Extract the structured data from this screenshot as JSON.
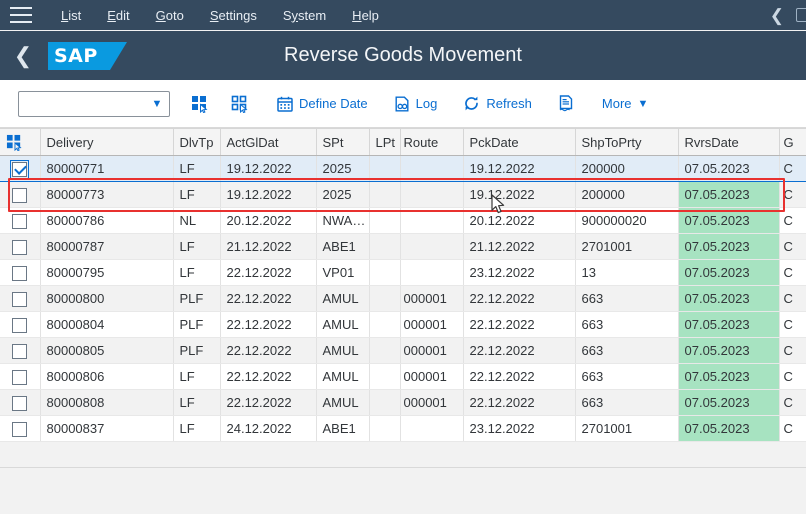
{
  "menubar": {
    "hamburger_icon": "hamburger-menu-icon",
    "items": [
      {
        "label": "List",
        "accel": "L"
      },
      {
        "label": "Edit",
        "accel": "E"
      },
      {
        "label": "Goto",
        "accel": "G"
      },
      {
        "label": "Settings",
        "accel": "S"
      },
      {
        "label": "System",
        "accel": "y"
      },
      {
        "label": "Help",
        "accel": "H"
      }
    ],
    "back_icon": "chevron-left-icon",
    "window_icon": "window-square-icon"
  },
  "shellbar": {
    "back_icon": "chevron-left-icon",
    "logo_text": "SAP",
    "title": "Reverse Goods Movement"
  },
  "toolbar": {
    "combo_value": "",
    "combo_placeholder": "",
    "combo_arrow_icon": "chevron-down-icon",
    "select_all_icon": "select-all-icon",
    "deselect_all_icon": "deselect-all-icon",
    "define_date_label": "Define Date",
    "define_date_icon": "calendar-icon",
    "log_label": "Log",
    "log_icon": "log-document-icon",
    "refresh_label": "Refresh",
    "refresh_icon": "refresh-icon",
    "detail_icon": "document-list-icon",
    "more_label": "More",
    "more_icon": "chevron-down-icon"
  },
  "table": {
    "select_all_header_icon": "select-all-icon",
    "columns": [
      "Delivery",
      "DlvTp",
      "ActGlDat",
      "SPt",
      "LPt",
      "Route",
      "PckDate",
      "ShpToPrty",
      "RvrsDate",
      "G"
    ],
    "rows": [
      {
        "selected": true,
        "delivery": "80000771",
        "dlvtp": "LF",
        "actgldat": "19.12.2022",
        "spt": "2025",
        "lpt": "",
        "route": "",
        "pckdate": "19.12.2022",
        "shptoprty": "200000",
        "rvrsdate": "07.05.2023",
        "g": "C"
      },
      {
        "selected": false,
        "delivery": "80000773",
        "dlvtp": "LF",
        "actgldat": "19.12.2022",
        "spt": "2025",
        "lpt": "",
        "route": "",
        "pckdate": "19.12.2022",
        "shptoprty": "200000",
        "rvrsdate": "07.05.2023",
        "g": "C"
      },
      {
        "selected": false,
        "delivery": "80000786",
        "dlvtp": "NL",
        "actgldat": "20.12.2022",
        "spt": "NWA…",
        "lpt": "",
        "route": "",
        "pckdate": "20.12.2022",
        "shptoprty": "900000020",
        "rvrsdate": "07.05.2023",
        "g": "C"
      },
      {
        "selected": false,
        "delivery": "80000787",
        "dlvtp": "LF",
        "actgldat": "21.12.2022",
        "spt": "ABE1",
        "lpt": "",
        "route": "",
        "pckdate": "21.12.2022",
        "shptoprty": "2701001",
        "rvrsdate": "07.05.2023",
        "g": "C"
      },
      {
        "selected": false,
        "delivery": "80000795",
        "dlvtp": "LF",
        "actgldat": "22.12.2022",
        "spt": "VP01",
        "lpt": "",
        "route": "",
        "pckdate": "23.12.2022",
        "shptoprty": "13",
        "rvrsdate": "07.05.2023",
        "g": "C"
      },
      {
        "selected": false,
        "delivery": "80000800",
        "dlvtp": "PLF",
        "actgldat": "22.12.2022",
        "spt": "AMUL",
        "lpt": "",
        "route": "000001",
        "pckdate": "22.12.2022",
        "shptoprty": "663",
        "rvrsdate": "07.05.2023",
        "g": "C"
      },
      {
        "selected": false,
        "delivery": "80000804",
        "dlvtp": "PLF",
        "actgldat": "22.12.2022",
        "spt": "AMUL",
        "lpt": "",
        "route": "000001",
        "pckdate": "22.12.2022",
        "shptoprty": "663",
        "rvrsdate": "07.05.2023",
        "g": "C"
      },
      {
        "selected": false,
        "delivery": "80000805",
        "dlvtp": "PLF",
        "actgldat": "22.12.2022",
        "spt": "AMUL",
        "lpt": "",
        "route": "000001",
        "pckdate": "22.12.2022",
        "shptoprty": "663",
        "rvrsdate": "07.05.2023",
        "g": "C"
      },
      {
        "selected": false,
        "delivery": "80000806",
        "dlvtp": "LF",
        "actgldat": "22.12.2022",
        "spt": "AMUL",
        "lpt": "",
        "route": "000001",
        "pckdate": "22.12.2022",
        "shptoprty": "663",
        "rvrsdate": "07.05.2023",
        "g": "C"
      },
      {
        "selected": false,
        "delivery": "80000808",
        "dlvtp": "LF",
        "actgldat": "22.12.2022",
        "spt": "AMUL",
        "lpt": "",
        "route": "000001",
        "pckdate": "22.12.2022",
        "shptoprty": "663",
        "rvrsdate": "07.05.2023",
        "g": "C"
      },
      {
        "selected": false,
        "delivery": "80000837",
        "dlvtp": "LF",
        "actgldat": "24.12.2022",
        "spt": "ABE1",
        "lpt": "",
        "route": "",
        "pckdate": "23.12.2022",
        "shptoprty": "2701001",
        "rvrsdate": "07.05.2023",
        "g": "C"
      }
    ]
  },
  "annotation": {
    "highlight_color": "#e8312f",
    "target_row_delivery": "80000771"
  },
  "colors": {
    "shell_bg": "#354a5f",
    "accent": "#0a6ed1",
    "logo_blue": "#0a9ae0",
    "row_selected": "#e1ecf7",
    "cell_green": "#a7e3c1"
  },
  "cursor": {
    "icon": "mouse-pointer-icon"
  }
}
